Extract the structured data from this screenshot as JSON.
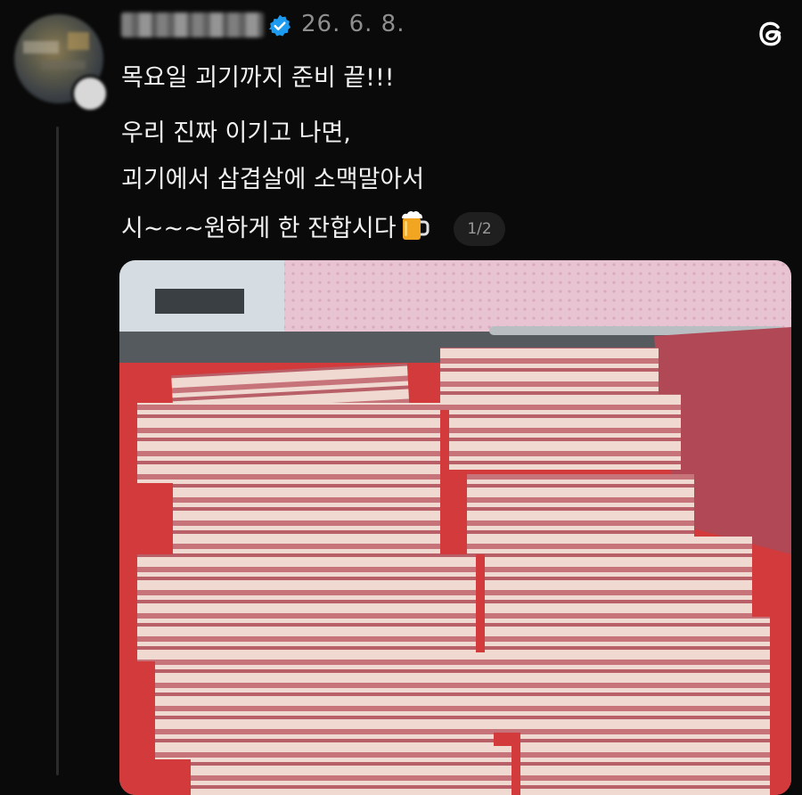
{
  "post": {
    "date": "26. 6. 8.",
    "lines": [
      "목요일 괴기까지 준비 끝!!!",
      "우리 진짜 이기고 나면,",
      "괴기에서 삼겹살에 소맥말아서",
      "시~~~원하게 한 잔합시다"
    ],
    "emoji": "beer-mug",
    "pager": "1/2"
  },
  "icons": {
    "verified": "verified-badge-icon",
    "logo": "threads-logo-icon"
  },
  "colors": {
    "background": "#0a0a0a",
    "verified": "#1d9bf0",
    "muted": "#8e8e8e"
  }
}
